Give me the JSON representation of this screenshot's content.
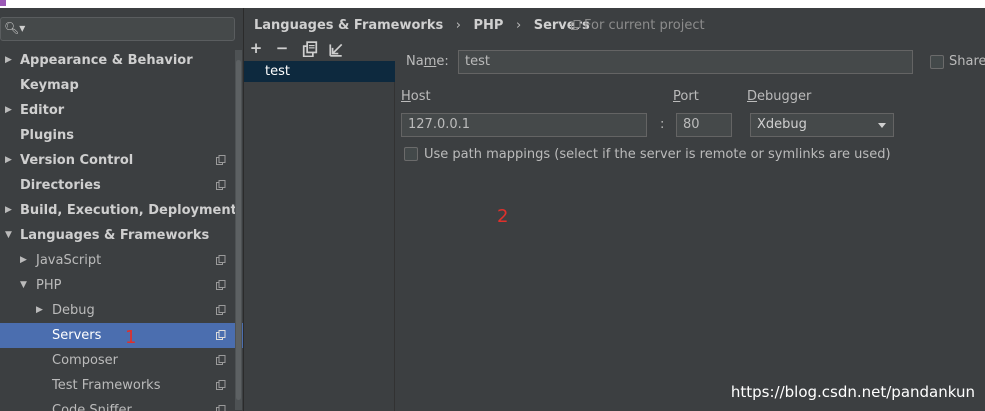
{
  "window": {
    "accent": "#9b59b6"
  },
  "search": {
    "placeholder": ""
  },
  "tree": {
    "items": [
      {
        "label": "Appearance & Behavior"
      },
      {
        "label": "Keymap"
      },
      {
        "label": "Editor"
      },
      {
        "label": "Plugins"
      },
      {
        "label": "Version Control"
      },
      {
        "label": "Directories"
      },
      {
        "label": "Build, Execution, Deployment"
      },
      {
        "label": "Languages & Frameworks"
      },
      {
        "label": "JavaScript"
      },
      {
        "label": "PHP"
      },
      {
        "label": "Debug"
      },
      {
        "label": "Servers"
      },
      {
        "label": "Composer"
      },
      {
        "label": "Test Frameworks"
      },
      {
        "label": "Code Sniffer"
      }
    ],
    "annotation": "1"
  },
  "breadcrumb": {
    "items": [
      "Languages & Frameworks",
      "PHP",
      "Servers"
    ],
    "separator": "›",
    "scope": "For current project"
  },
  "toolbar": {
    "add": "+",
    "remove": "−"
  },
  "servers": {
    "items": [
      "test"
    ]
  },
  "form": {
    "name_label_pre": "Na",
    "name_label_mn": "m",
    "name_label_post": "e:",
    "name_value": "test",
    "shared_label": "Shared",
    "host_label_h": "H",
    "host_label_rest": "ost",
    "host_value": "127.0.0.1",
    "colon": ":",
    "port_label_p": "P",
    "port_label_rest": "ort",
    "port_value": "80",
    "debugger_label_d": "D",
    "debugger_label_rest": "ebugger",
    "debugger_value": "Xdebug",
    "path_mappings_label": "Use path mappings (select if the server is remote or symlinks are used)",
    "annotation": "2"
  },
  "watermark": "https://blog.csdn.net/pandankun",
  "colors": {
    "selection": "#4b6eaf",
    "list_selection": "#0d293e",
    "annotation": "#e0302b"
  }
}
